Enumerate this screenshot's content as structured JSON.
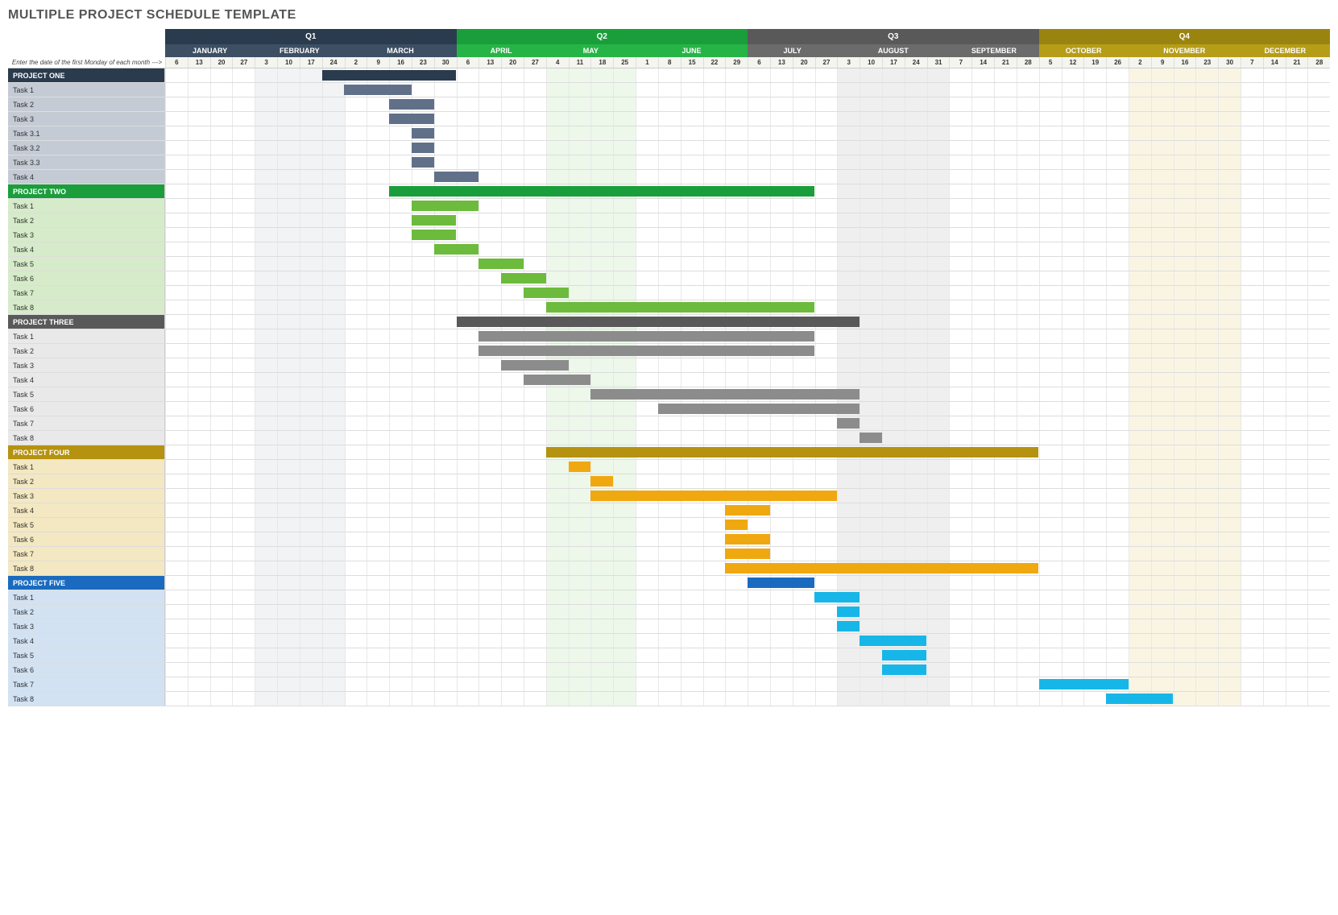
{
  "title": "MULTIPLE PROJECT SCHEDULE TEMPLATE",
  "instruction": "Enter the date of the first Monday of each month --->",
  "quarters": [
    {
      "label": "Q1",
      "cls": "q1",
      "mcls": "m1",
      "months": [
        {
          "label": "JANUARY",
          "days": [
            6,
            13,
            20,
            27
          ]
        },
        {
          "label": "FEBRUARY",
          "days": [
            3,
            10,
            17,
            24
          ]
        },
        {
          "label": "MARCH",
          "days": [
            2,
            9,
            16,
            23,
            30
          ]
        }
      ]
    },
    {
      "label": "Q2",
      "cls": "q2",
      "mcls": "m2",
      "months": [
        {
          "label": "APRIL",
          "days": [
            6,
            13,
            20,
            27
          ]
        },
        {
          "label": "MAY",
          "days": [
            4,
            11,
            18,
            25
          ]
        },
        {
          "label": "JUNE",
          "days": [
            1,
            8,
            15,
            22,
            29
          ]
        }
      ]
    },
    {
      "label": "Q3",
      "cls": "q3",
      "mcls": "m3",
      "months": [
        {
          "label": "JULY",
          "days": [
            6,
            13,
            20,
            27
          ]
        },
        {
          "label": "AUGUST",
          "days": [
            3,
            10,
            17,
            24,
            31
          ]
        },
        {
          "label": "SEPTEMBER",
          "days": [
            7,
            14,
            21,
            28
          ]
        }
      ]
    },
    {
      "label": "Q4",
      "cls": "q4",
      "mcls": "m4",
      "months": [
        {
          "label": "OCTOBER",
          "days": [
            5,
            12,
            19,
            26
          ]
        },
        {
          "label": "NOVEMBER",
          "days": [
            2,
            9,
            16,
            23,
            30
          ]
        },
        {
          "label": "DECEMBER",
          "days": [
            7,
            14,
            21,
            28
          ]
        }
      ]
    }
  ],
  "projects": [
    {
      "name": "PROJECT ONE",
      "hcls": "p1h",
      "tcls": "p1t",
      "bar": "bh1",
      "tb": "b1",
      "start": 8,
      "len": 6,
      "tasks": [
        {
          "n": "Task 1",
          "s": 9,
          "l": 3
        },
        {
          "n": "Task 2",
          "s": 11,
          "l": 2
        },
        {
          "n": "Task 3",
          "s": 11,
          "l": 2
        },
        {
          "n": "Task 3.1",
          "s": 12,
          "l": 1
        },
        {
          "n": "Task 3.2",
          "s": 12,
          "l": 1
        },
        {
          "n": "Task 3.3",
          "s": 12,
          "l": 1
        },
        {
          "n": "Task 4",
          "s": 13,
          "l": 2
        }
      ]
    },
    {
      "name": "PROJECT TWO",
      "hcls": "p2h",
      "tcls": "p2t",
      "bar": "bh2",
      "tb": "b2",
      "start": 11,
      "len": 19,
      "tasks": [
        {
          "n": "Task 1",
          "s": 12,
          "l": 3
        },
        {
          "n": "Task 2",
          "s": 12,
          "l": 2
        },
        {
          "n": "Task 3",
          "s": 12,
          "l": 2
        },
        {
          "n": "Task 4",
          "s": 13,
          "l": 2
        },
        {
          "n": "Task 5",
          "s": 15,
          "l": 2
        },
        {
          "n": "Task 6",
          "s": 16,
          "l": 2
        },
        {
          "n": "Task 7",
          "s": 17,
          "l": 2
        },
        {
          "n": "Task 8",
          "s": 18,
          "l": 12
        }
      ]
    },
    {
      "name": "PROJECT THREE",
      "hcls": "p3h",
      "tcls": "p3t",
      "bar": "bh3",
      "tb": "b3",
      "start": 14,
      "len": 18,
      "tasks": [
        {
          "n": "Task 1",
          "s": 15,
          "l": 15
        },
        {
          "n": "Task 2",
          "s": 15,
          "l": 15
        },
        {
          "n": "Task 3",
          "s": 16,
          "l": 3
        },
        {
          "n": "Task 4",
          "s": 17,
          "l": 3
        },
        {
          "n": "Task 5",
          "s": 20,
          "l": 12
        },
        {
          "n": "Task 6",
          "s": 23,
          "l": 9
        },
        {
          "n": "Task 7",
          "s": 31,
          "l": 1
        },
        {
          "n": "Task 8",
          "s": 32,
          "l": 1
        }
      ]
    },
    {
      "name": "PROJECT FOUR",
      "hcls": "p4h",
      "tcls": "p4t",
      "bar": "bh4",
      "tb": "b4",
      "start": 18,
      "len": 22,
      "tasks": [
        {
          "n": "Task 1",
          "s": 19,
          "l": 1
        },
        {
          "n": "Task 2",
          "s": 20,
          "l": 1
        },
        {
          "n": "Task 3",
          "s": 20,
          "l": 11
        },
        {
          "n": "Task 4",
          "s": 26,
          "l": 2
        },
        {
          "n": "Task 5",
          "s": 26,
          "l": 1
        },
        {
          "n": "Task 6",
          "s": 26,
          "l": 2
        },
        {
          "n": "Task 7",
          "s": 26,
          "l": 2
        },
        {
          "n": "Task 8",
          "s": 26,
          "l": 14
        }
      ]
    },
    {
      "name": "PROJECT FIVE",
      "hcls": "p5h",
      "tcls": "p5t",
      "bar": "bh5",
      "tb": "b5",
      "start": 27,
      "len": 3,
      "tasks": [
        {
          "n": "Task 1",
          "s": 30,
          "l": 2
        },
        {
          "n": "Task 2",
          "s": 31,
          "l": 1
        },
        {
          "n": "Task 3",
          "s": 31,
          "l": 1
        },
        {
          "n": "Task 4",
          "s": 32,
          "l": 3
        },
        {
          "n": "Task 5",
          "s": 33,
          "l": 2
        },
        {
          "n": "Task 6",
          "s": 33,
          "l": 2
        },
        {
          "n": "Task 7",
          "s": 40,
          "l": 4
        },
        {
          "n": "Task 8",
          "s": 43,
          "l": 3
        }
      ]
    }
  ],
  "chart_data": {
    "type": "gantt",
    "title": "Multiple Project Schedule Template",
    "x_unit": "week",
    "total_weeks": 52,
    "quarters": [
      "Q1",
      "Q2",
      "Q3",
      "Q4"
    ],
    "months": [
      "JANUARY",
      "FEBRUARY",
      "MARCH",
      "APRIL",
      "MAY",
      "JUNE",
      "JULY",
      "AUGUST",
      "SEPTEMBER",
      "OCTOBER",
      "NOVEMBER",
      "DECEMBER"
    ],
    "week_start_days": [
      [
        6,
        13,
        20,
        27
      ],
      [
        3,
        10,
        17,
        24
      ],
      [
        2,
        9,
        16,
        23,
        30
      ],
      [
        6,
        13,
        20,
        27
      ],
      [
        4,
        11,
        18,
        25
      ],
      [
        1,
        8,
        15,
        22,
        29
      ],
      [
        6,
        13,
        20,
        27
      ],
      [
        3,
        10,
        17,
        24,
        31
      ],
      [
        7,
        14,
        21,
        28
      ],
      [
        5,
        12,
        19,
        26
      ],
      [
        2,
        9,
        16,
        23,
        30
      ],
      [
        7,
        14,
        21,
        28
      ]
    ],
    "series": [
      {
        "name": "PROJECT ONE",
        "color": "#2a3b4d",
        "start_week": 8,
        "duration_weeks": 6,
        "tasks": [
          [
            "Task 1",
            9,
            3
          ],
          [
            "Task 2",
            11,
            2
          ],
          [
            "Task 3",
            11,
            2
          ],
          [
            "Task 3.1",
            12,
            1
          ],
          [
            "Task 3.2",
            12,
            1
          ],
          [
            "Task 3.3",
            12,
            1
          ],
          [
            "Task 4",
            13,
            2
          ]
        ]
      },
      {
        "name": "PROJECT TWO",
        "color": "#1a9e3b",
        "start_week": 11,
        "duration_weeks": 19,
        "tasks": [
          [
            "Task 1",
            12,
            3
          ],
          [
            "Task 2",
            12,
            2
          ],
          [
            "Task 3",
            12,
            2
          ],
          [
            "Task 4",
            13,
            2
          ],
          [
            "Task 5",
            15,
            2
          ],
          [
            "Task 6",
            16,
            2
          ],
          [
            "Task 7",
            17,
            2
          ],
          [
            "Task 8",
            18,
            12
          ]
        ]
      },
      {
        "name": "PROJECT THREE",
        "color": "#595959",
        "start_week": 14,
        "duration_weeks": 18,
        "tasks": [
          [
            "Task 1",
            15,
            15
          ],
          [
            "Task 2",
            15,
            15
          ],
          [
            "Task 3",
            16,
            3
          ],
          [
            "Task 4",
            17,
            3
          ],
          [
            "Task 5",
            20,
            12
          ],
          [
            "Task 6",
            23,
            9
          ],
          [
            "Task 7",
            31,
            1
          ],
          [
            "Task 8",
            32,
            1
          ]
        ]
      },
      {
        "name": "PROJECT FOUR",
        "color": "#b5920f",
        "start_week": 18,
        "duration_weeks": 22,
        "tasks": [
          [
            "Task 1",
            19,
            1
          ],
          [
            "Task 2",
            20,
            1
          ],
          [
            "Task 3",
            20,
            11
          ],
          [
            "Task 4",
            26,
            2
          ],
          [
            "Task 5",
            26,
            1
          ],
          [
            "Task 6",
            26,
            2
          ],
          [
            "Task 7",
            26,
            2
          ],
          [
            "Task 8",
            26,
            14
          ]
        ]
      },
      {
        "name": "PROJECT FIVE",
        "color": "#1a6bbf",
        "start_week": 27,
        "duration_weeks": 3,
        "tasks": [
          [
            "Task 1",
            30,
            2
          ],
          [
            "Task 2",
            31,
            1
          ],
          [
            "Task 3",
            31,
            1
          ],
          [
            "Task 4",
            32,
            3
          ],
          [
            "Task 5",
            33,
            2
          ],
          [
            "Task 6",
            33,
            2
          ],
          [
            "Task 7",
            40,
            4
          ],
          [
            "Task 8",
            43,
            3
          ]
        ]
      }
    ]
  }
}
